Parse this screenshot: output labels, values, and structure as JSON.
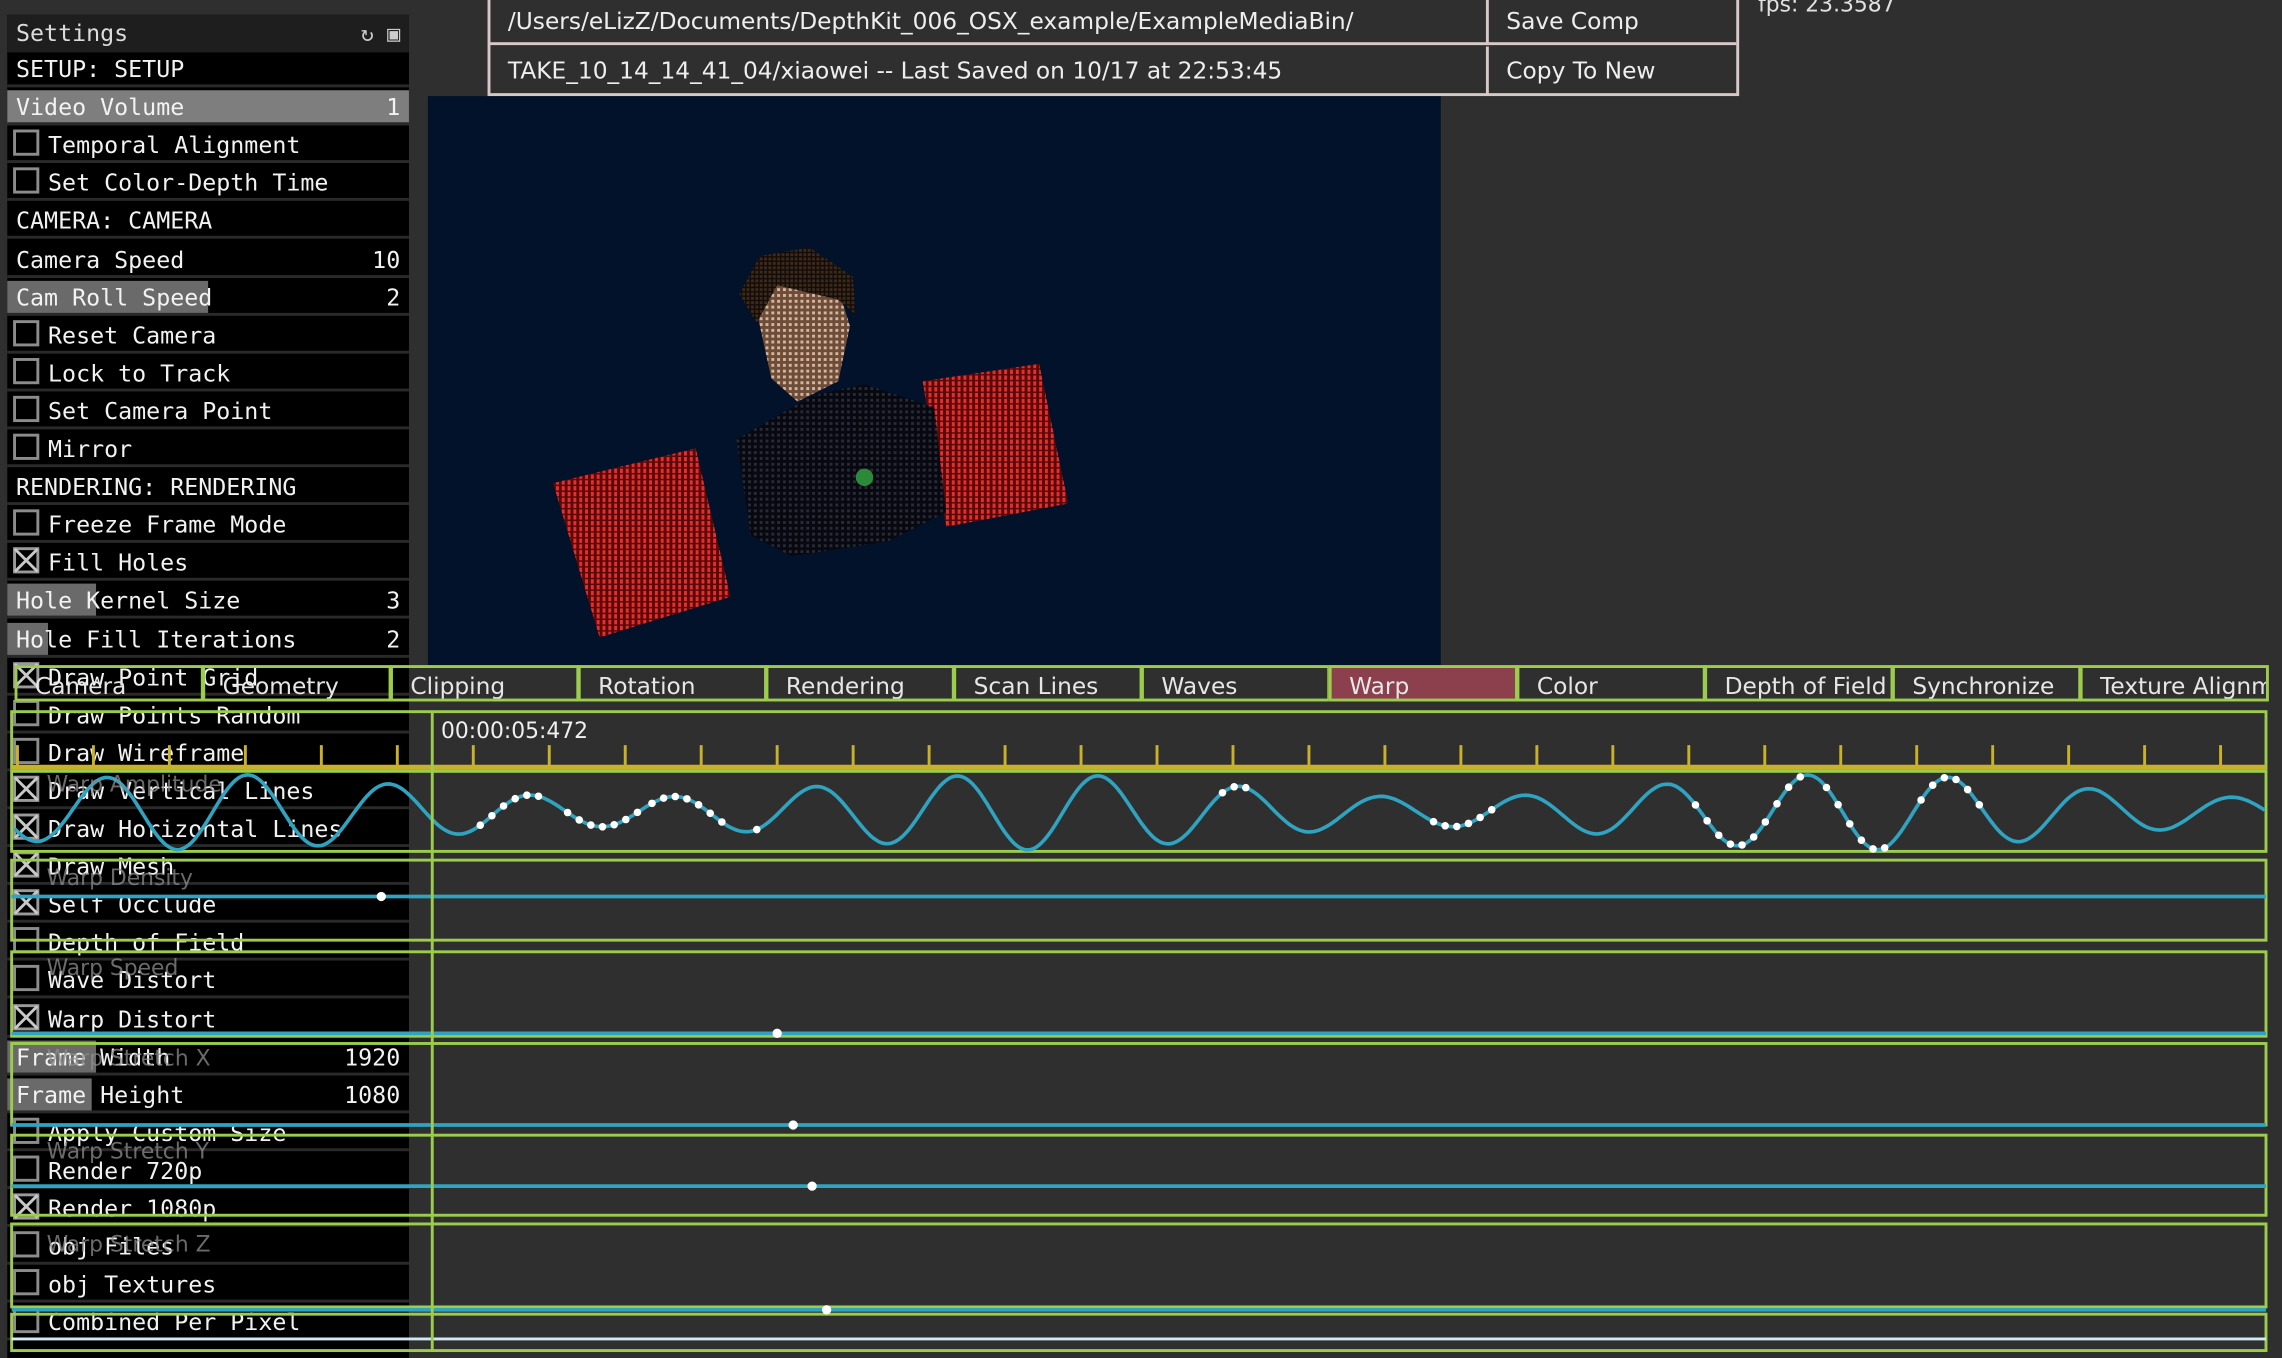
{
  "settings": {
    "title": "Settings",
    "title_icons": [
      "refresh-icon",
      "save-icon"
    ],
    "rows": [
      {
        "type": "section",
        "label": "SETUP: SETUP"
      },
      {
        "type": "slider",
        "label": "Video Volume",
        "value": "1",
        "level": 1.0
      },
      {
        "type": "toggle",
        "label": "Temporal Alignment",
        "checked": false
      },
      {
        "type": "toggle",
        "label": "Set Color-Depth Time",
        "checked": false
      },
      {
        "type": "section",
        "label": "CAMERA: CAMERA"
      },
      {
        "type": "slider",
        "label": "Camera Speed",
        "value": "10",
        "level": 0.0
      },
      {
        "type": "slider",
        "label": "Cam Roll Speed",
        "value": "2",
        "level": 0.5
      },
      {
        "type": "toggle",
        "label": "Reset Camera",
        "checked": false
      },
      {
        "type": "toggle",
        "label": "Lock to Track",
        "checked": false
      },
      {
        "type": "toggle",
        "label": "Set Camera Point",
        "checked": false
      },
      {
        "type": "toggle",
        "label": "Mirror",
        "checked": false
      },
      {
        "type": "section",
        "label": "RENDERING: RENDERING"
      },
      {
        "type": "toggle",
        "label": "Freeze Frame Mode",
        "checked": false
      },
      {
        "type": "toggle",
        "label": "Fill Holes",
        "checked": true
      },
      {
        "type": "slider",
        "label": "Hole Kernel Size",
        "value": "3",
        "level": 0.22
      },
      {
        "type": "slider",
        "label": "Hole Fill Iterations",
        "value": "2",
        "level": 0.1
      },
      {
        "type": "toggle",
        "label": "Draw Point Grid",
        "checked": true
      },
      {
        "type": "toggle",
        "label": "Draw Points Random",
        "checked": false
      },
      {
        "type": "toggle",
        "label": "Draw Wireframe",
        "checked": false
      },
      {
        "type": "toggle",
        "label": "Draw Vertical Lines",
        "checked": true
      },
      {
        "type": "toggle",
        "label": "Draw Horizontal Lines",
        "checked": true
      },
      {
        "type": "toggle",
        "label": "Draw Mesh",
        "checked": true
      },
      {
        "type": "toggle",
        "label": "Self Occlude",
        "checked": true
      },
      {
        "type": "toggle",
        "label": "Depth of Field",
        "checked": false
      },
      {
        "type": "toggle",
        "label": "Wave Distort",
        "checked": false
      },
      {
        "type": "toggle",
        "label": "Warp Distort",
        "checked": true
      },
      {
        "type": "slider",
        "label": "Frame Width",
        "value": "1920",
        "level": 0.22
      },
      {
        "type": "slider",
        "label": "Frame Height",
        "value": "1080",
        "level": 0.21
      },
      {
        "type": "toggle",
        "label": "Apply Custom Size",
        "checked": false
      },
      {
        "type": "toggle",
        "label": "Render 720p",
        "checked": false
      },
      {
        "type": "toggle",
        "label": "Render 1080p",
        "checked": true
      },
      {
        "type": "toggle",
        "label": "obj Files",
        "checked": false
      },
      {
        "type": "toggle",
        "label": "obj Textures",
        "checked": false
      },
      {
        "type": "toggle",
        "label": "Combined Per Pixel",
        "checked": false
      }
    ]
  },
  "header": {
    "path": "/Users/eLizZ/Documents/DepthKit_006_OSX_example/ExampleMediaBin/",
    "save_label": "Save Comp",
    "take": "TAKE_10_14_14_41_04/xiaowei -- Last Saved on 10/17 at 22:53:45",
    "copy_label": "Copy To New"
  },
  "fps": "fps: 23.3587",
  "timeline": {
    "tabs": [
      "Camera",
      "Geometry",
      "Clipping",
      "Rotation",
      "Rendering",
      "Scan Lines",
      "Waves",
      "Warp",
      "Color",
      "Depth of Field",
      "Synchronize",
      "Texture Alignm"
    ],
    "active_tab": "Warp",
    "timecode": "00:00:05:472",
    "tracks": [
      {
        "label": "Warp Amplitude",
        "kind": "curve"
      },
      {
        "label": "Warp Density",
        "kind": "flat",
        "level": 0.24
      },
      {
        "label": "Warp Speed",
        "kind": "flat",
        "level": 0.35
      },
      {
        "label": "Warp Stretch X",
        "kind": "flat",
        "level": 0.34
      },
      {
        "label": "Warp Stretch Y",
        "kind": "flat",
        "level": 0.35
      },
      {
        "label": "Warp Stretch Z",
        "kind": "flat",
        "level": 0.1
      }
    ]
  },
  "colors": {
    "accent_green": "#9ccc4c",
    "curve_blue": "#2fa3c0",
    "ruler_yellow": "#c9b229",
    "active_tab": "#8c3f4d",
    "viewport_bg": "#02122a"
  }
}
